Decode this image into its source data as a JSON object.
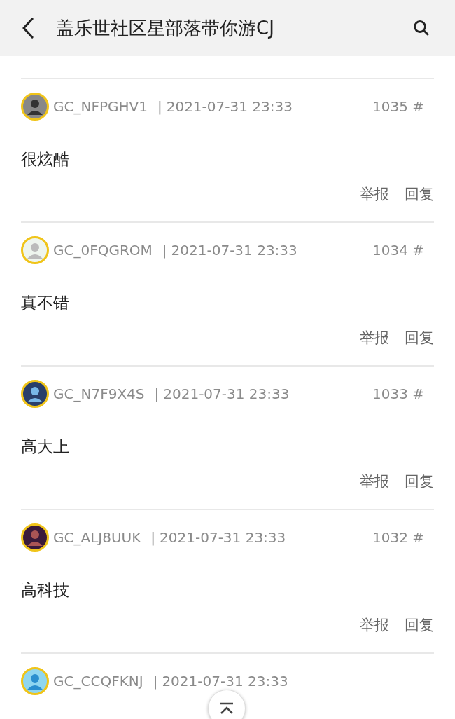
{
  "header": {
    "title": "盖乐世社区星部落带你游CJ"
  },
  "posts": [
    {
      "user": "GC_NFPGHV1",
      "separator": "|",
      "time": "2021-07-31 23:33",
      "floor": "1035 #",
      "content": "很炫酷",
      "actions": [
        "举报",
        "回复"
      ]
    },
    {
      "user": "GC_0FQGROM",
      "separator": "|",
      "time": "2021-07-31 23:33",
      "floor": "1034 #",
      "content": "真不错",
      "actions": [
        "举报",
        "回复"
      ]
    },
    {
      "user": "GC_N7F9X4S",
      "separator": "|",
      "time": "2021-07-31 23:33",
      "floor": "1033 #",
      "content": "高大上",
      "actions": [
        "举报",
        "回复"
      ]
    },
    {
      "user": "GC_ALJ8UUK",
      "separator": "|",
      "time": "2021-07-31 23:33",
      "floor": "1032 #",
      "content": "高科技",
      "actions": [
        "举报",
        "回复"
      ]
    },
    {
      "user": "GC_CCQFKNJ",
      "separator": "|",
      "time": "2021-07-31 23:33"
    }
  ]
}
